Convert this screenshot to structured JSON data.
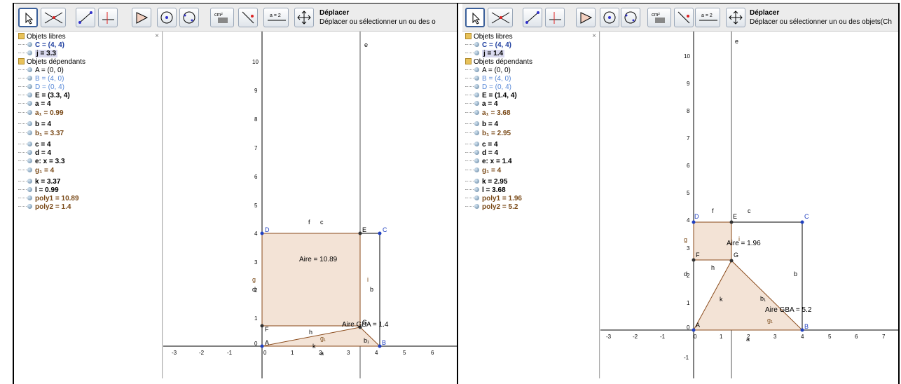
{
  "left": {
    "toolbar": {
      "tool_name": "Déplacer",
      "tool_help": "Déplacer ou sélectionner un ou des o",
      "area_label": "cm²",
      "slider_label": "a = 2"
    },
    "algebra": {
      "close": "×",
      "free_header": "Objets libres",
      "dep_header": "Objets dépendants",
      "free": [
        "C = (4, 4)",
        "j = 3.3"
      ],
      "dependent": [
        "A = (0, 0)",
        "B = (4, 0)",
        "D = (0, 4)",
        "E = (3.3, 4)",
        "a = 4",
        "a₁ = 0.99",
        "b = 4",
        "b₁ = 3.37",
        "c = 4",
        "d = 4",
        "e: x = 3.3",
        "g₁ = 4",
        "k = 3.37",
        "l = 0.99",
        "poly1 = 10.89",
        "poly2 = 1.4"
      ]
    },
    "graph": {
      "x_ticks": [
        "-3",
        "-2",
        "-1",
        "0",
        "1",
        "2",
        "3",
        "4",
        "5",
        "6"
      ],
      "y_ticks": [
        "1",
        "2",
        "3",
        "4",
        "5",
        "6",
        "7",
        "8",
        "9",
        "10"
      ],
      "aire_rect": "Aire = 10.89",
      "aire_tri": "Aire GBA = 1.4",
      "labels": {
        "A": "A",
        "B": "B",
        "C": "C",
        "D": "D",
        "E": "E",
        "F": "F",
        "G": "G",
        "e": "e",
        "f": "f",
        "c": "c",
        "g": "g",
        "d": "d",
        "i": "i",
        "b": "b",
        "h": "h",
        "g1": "g₁",
        "k": "k",
        "b1": "b₁",
        "a": "a",
        "zero": "0"
      }
    }
  },
  "right": {
    "toolbar": {
      "tool_name": "Déplacer",
      "tool_help": "Déplacer ou sélectionner un ou des objets(Ch",
      "area_label": "cm²",
      "slider_label": "a = 2"
    },
    "algebra": {
      "close": "×",
      "free_header": "Objets libres",
      "dep_header": "Objets dépendants",
      "free": [
        "C = (4, 4)",
        "j = 1.4"
      ],
      "dependent": [
        "A = (0, 0)",
        "B = (4, 0)",
        "D = (0, 4)",
        "E = (1.4, 4)",
        "a = 4",
        "a₁ = 3.68",
        "b = 4",
        "b₁ = 2.95",
        "c = 4",
        "d = 4",
        "e: x = 1.4",
        "g₁ = 4",
        "k = 2.95",
        "l = 3.68",
        "poly1 = 1.96",
        "poly2 = 5.2"
      ]
    },
    "graph": {
      "x_ticks": [
        "-3",
        "-2",
        "-1",
        "0",
        "1",
        "2",
        "3",
        "4",
        "5",
        "6",
        "7"
      ],
      "y_ticks": [
        "-1",
        "1",
        "2",
        "3",
        "4",
        "5",
        "6",
        "7",
        "8",
        "9",
        "10"
      ],
      "aire_rect": "Aire = 1.96",
      "aire_tri": "Aire GBA = 5.2",
      "labels": {
        "A": "A",
        "B": "B",
        "C": "C",
        "D": "D",
        "E": "E",
        "F": "F",
        "G": "G",
        "e": "e",
        "f": "f",
        "c": "c",
        "g": "g",
        "d": "d",
        "i": "i",
        "b": "b",
        "h": "h",
        "g1": "g₁",
        "k": "k",
        "b1": "b₁",
        "a": "a",
        "zero": "0"
      }
    }
  },
  "colors": {
    "fill": "#f3e3d6",
    "edge": "#8a4a1a",
    "point_blue": "#2040c0",
    "point_black": "#333333"
  }
}
